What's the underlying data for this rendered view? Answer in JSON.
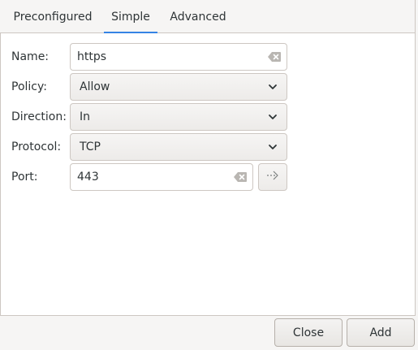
{
  "tabs": [
    {
      "label": "Preconfigured"
    },
    {
      "label": "Simple"
    },
    {
      "label": "Advanced"
    }
  ],
  "active_tab": "Simple",
  "form": {
    "name_label": "Name:",
    "name_value": "https",
    "policy_label": "Policy:",
    "policy_value": "Allow",
    "direction_label": "Direction:",
    "direction_value": "In",
    "protocol_label": "Protocol:",
    "protocol_value": "TCP",
    "port_label": "Port:",
    "port_value": "443"
  },
  "buttons": {
    "close_label": "Close",
    "add_label": "Add"
  },
  "icons": {
    "clear": "edit-clear-icon",
    "dropdown": "chevron-down-icon",
    "port_action": "go-next-icon"
  },
  "colors": {
    "accent": "#3584e4"
  }
}
